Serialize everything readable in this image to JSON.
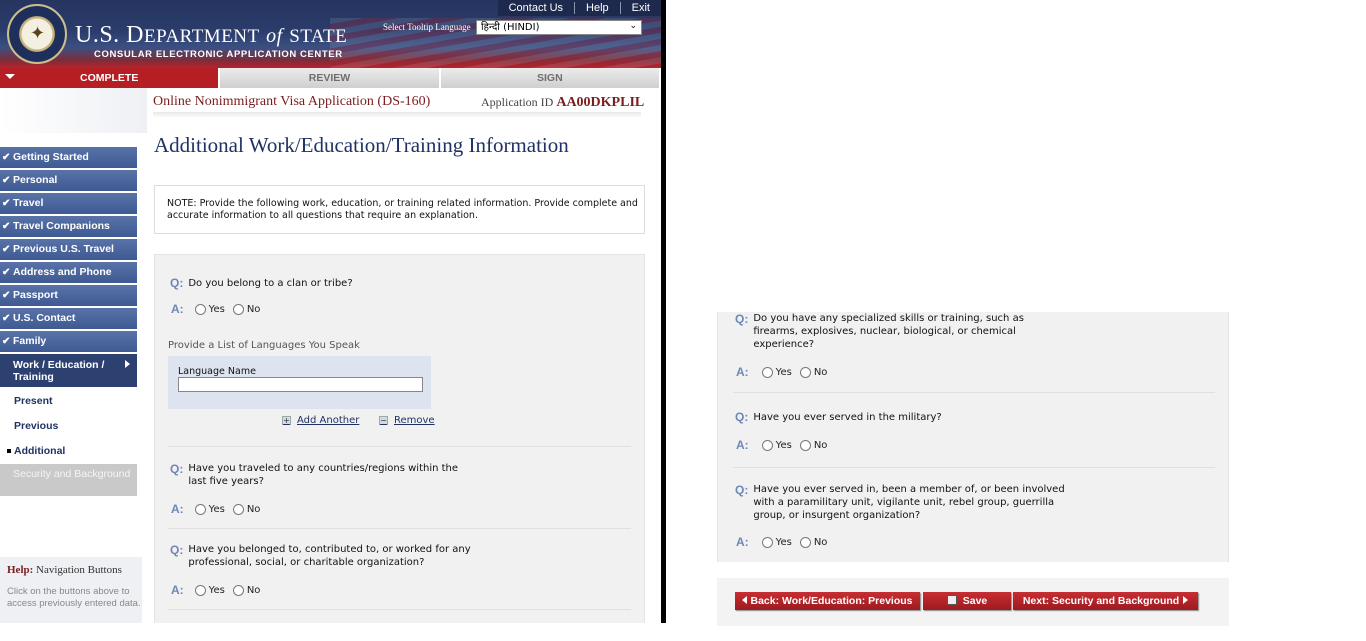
{
  "header": {
    "top_links": [
      "Contact Us",
      "Help",
      "Exit"
    ],
    "brand_line1_a": "U.S. D",
    "brand_line1_b": "EPARTMENT",
    "brand_of": "of",
    "brand_line1_c": "STATE",
    "brand_line2": "CONSULAR ELECTRONIC APPLICATION CENTER",
    "tooltip_label": "Select Tooltip Language",
    "tooltip_value": "हिन्दी (HINDI)"
  },
  "tabs": [
    "COMPLETE",
    "REVIEW",
    "SIGN"
  ],
  "form": {
    "title": "Online Nonimmigrant Visa Application (DS-160)",
    "app_id_label": "Application ID",
    "app_id": "AA00DKPLIL"
  },
  "sidenav": {
    "items": [
      "Getting Started",
      "Personal",
      "Travel",
      "Travel Companions",
      "Previous U.S. Travel",
      "Address and Phone",
      "Passport",
      "U.S. Contact",
      "Family"
    ],
    "current": "Work / Education / Training",
    "subs": [
      "Present",
      "Previous",
      "Additional"
    ],
    "disabled": "Security and Background"
  },
  "help": {
    "label": "Help:",
    "title": "Navigation Buttons",
    "body": "Click on the buttons above to access previously entered data."
  },
  "page": {
    "title": "Additional Work/Education/Training Information",
    "note": "NOTE: Provide the following work, education, or training related information. Provide complete and accurate information to all questions that require an explanation."
  },
  "labels": {
    "q": "Q:",
    "a": "A:",
    "yes": "Yes",
    "no": "No"
  },
  "questions_left": {
    "clan": "Do you belong to a clan or tribe?",
    "lang_section": "Provide a List of Languages You Speak",
    "lang_name": "Language Name",
    "add_another": "Add Another",
    "remove": "Remove",
    "traveled": "Have you traveled to any countries/regions within the last five years?",
    "belonged": "Have you belonged to, contributed to, or worked for any professional, social, or charitable organization?"
  },
  "questions_right": {
    "skills": "Do you have any specialized skills or training, such as firearms, explosives, nuclear, biological, or chemical experience?",
    "military": "Have you ever served in the military?",
    "paramilitary": "Have you ever served in, been a member of, or been involved with a paramilitary unit, vigilante unit, rebel group, guerrilla group, or insurgent organization?"
  },
  "buttons": {
    "back": "Back: Work/Education: Previous",
    "save": "Save",
    "next": "Next: Security and Background"
  }
}
